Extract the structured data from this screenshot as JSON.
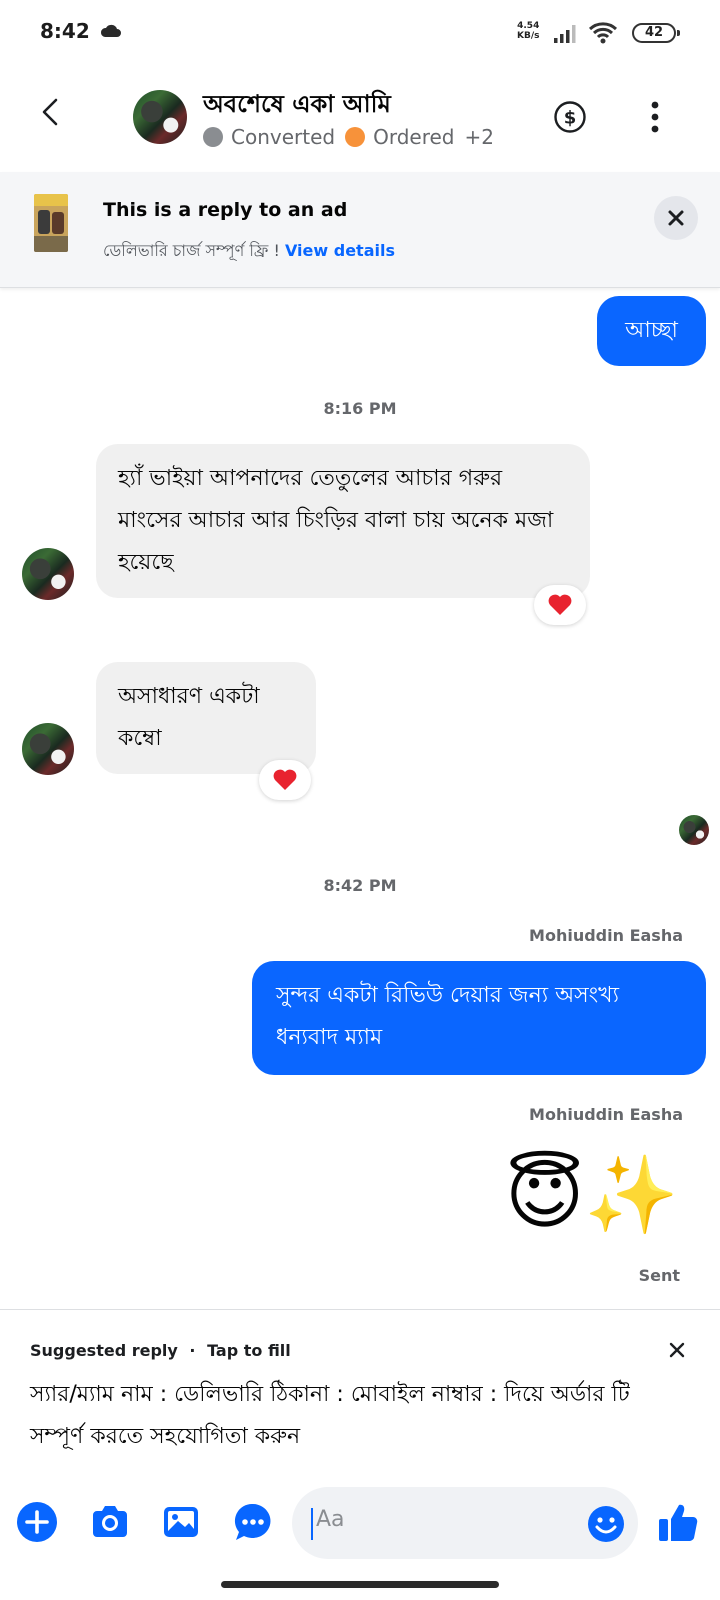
{
  "status_bar": {
    "time": "8:42",
    "net_speed_value": "4.54",
    "net_speed_unit": "KB/s",
    "battery": "42",
    "icons": [
      "cloud-icon",
      "signal-icon",
      "wifi-icon",
      "battery-icon"
    ]
  },
  "header": {
    "name": "অবশেষে একা আমি",
    "labels": [
      {
        "text": "Converted",
        "color": "#8a8d91"
      },
      {
        "text": "Ordered",
        "color": "#f7923a"
      }
    ],
    "more_labels": "+2"
  },
  "ad_banner": {
    "title": "This is a reply to an ad",
    "subtitle": "ডেলিভারি চার্জ সম্পূর্ণ ফ্রি !",
    "link": "View details"
  },
  "messages": {
    "m1": {
      "text": "আচ্ছা",
      "direction": "outgoing"
    },
    "time1": "8:16 PM",
    "m2": {
      "text": "হ্যাঁ ভাইয়া আপনাদের তেতুলের আচার গরুর মাংসের আচার আর চিংড়ির বালা চায় অনেক মজা হয়েছে",
      "reaction": "❤️",
      "direction": "incoming"
    },
    "m3": {
      "text": "অসাধারণ একটা কম্বো",
      "reaction": "❤️",
      "direction": "incoming"
    },
    "time2": "8:42 PM",
    "sender1": "Mohiuddin Easha",
    "m4": {
      "text": "সুন্দর একটা রিভিউ দেয়ার জন্য অসংখ্য ধন্যবাদ ম্যাম",
      "direction": "outgoing"
    },
    "sender2": "Mohiuddin Easha",
    "m5": {
      "text": "😇✨",
      "direction": "outgoing"
    },
    "status": "Sent"
  },
  "suggested_reply": {
    "label": "Suggested reply",
    "separator": "·",
    "hint": "Tap to fill",
    "text": "স্যার/ম্যাম নাম : ডেলিভারি ঠিকানা : মোবাইল নাম্বার : দিয়ে অর্ডার টি সম্পূর্ণ করতে সহযোগিতা করুন"
  },
  "composer": {
    "placeholder": "Aa",
    "accent": "#0866ff",
    "icons": [
      "plus-icon",
      "camera-icon",
      "gallery-icon",
      "chat-bubble-icon",
      "emoji-icon",
      "thumbs-up-icon"
    ]
  }
}
